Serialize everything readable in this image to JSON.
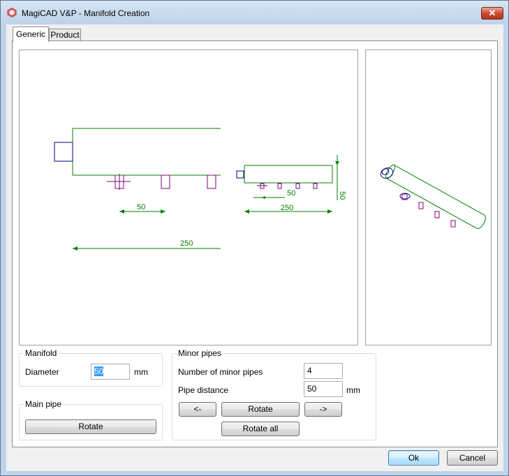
{
  "window": {
    "title": "MagiCAD V&P - Manifold Creation",
    "close_label": "✕"
  },
  "tabs": [
    {
      "label": "Generic",
      "active": true
    },
    {
      "label": "Product",
      "active": false
    }
  ],
  "drawing": {
    "dim_pipe_distance": "50",
    "dim_total_length": "250",
    "side_dim_height": "50",
    "side_dim_pipe": "50",
    "side_dim_length": "250"
  },
  "manifold": {
    "group_title": "Manifold",
    "diameter_label": "Diameter",
    "diameter_value": "50",
    "diameter_unit": "mm"
  },
  "main_pipe": {
    "group_title": "Main pipe",
    "rotate_label": "Rotate"
  },
  "minor_pipes": {
    "group_title": "Minor pipes",
    "count_label": "Number of minor pipes",
    "count_value": "4",
    "distance_label": "Pipe distance",
    "distance_value": "50",
    "distance_unit": "mm",
    "prev_label": "<-",
    "rotate_label": "Rotate",
    "next_label": "->",
    "rotate_all_label": "Rotate all"
  },
  "footer": {
    "ok_label": "Ok",
    "cancel_label": "Cancel"
  },
  "colors": {
    "dimension": "#008000",
    "manifold_body": "#008000",
    "end_cap": "#000080",
    "minor_pipe": "#800080"
  }
}
